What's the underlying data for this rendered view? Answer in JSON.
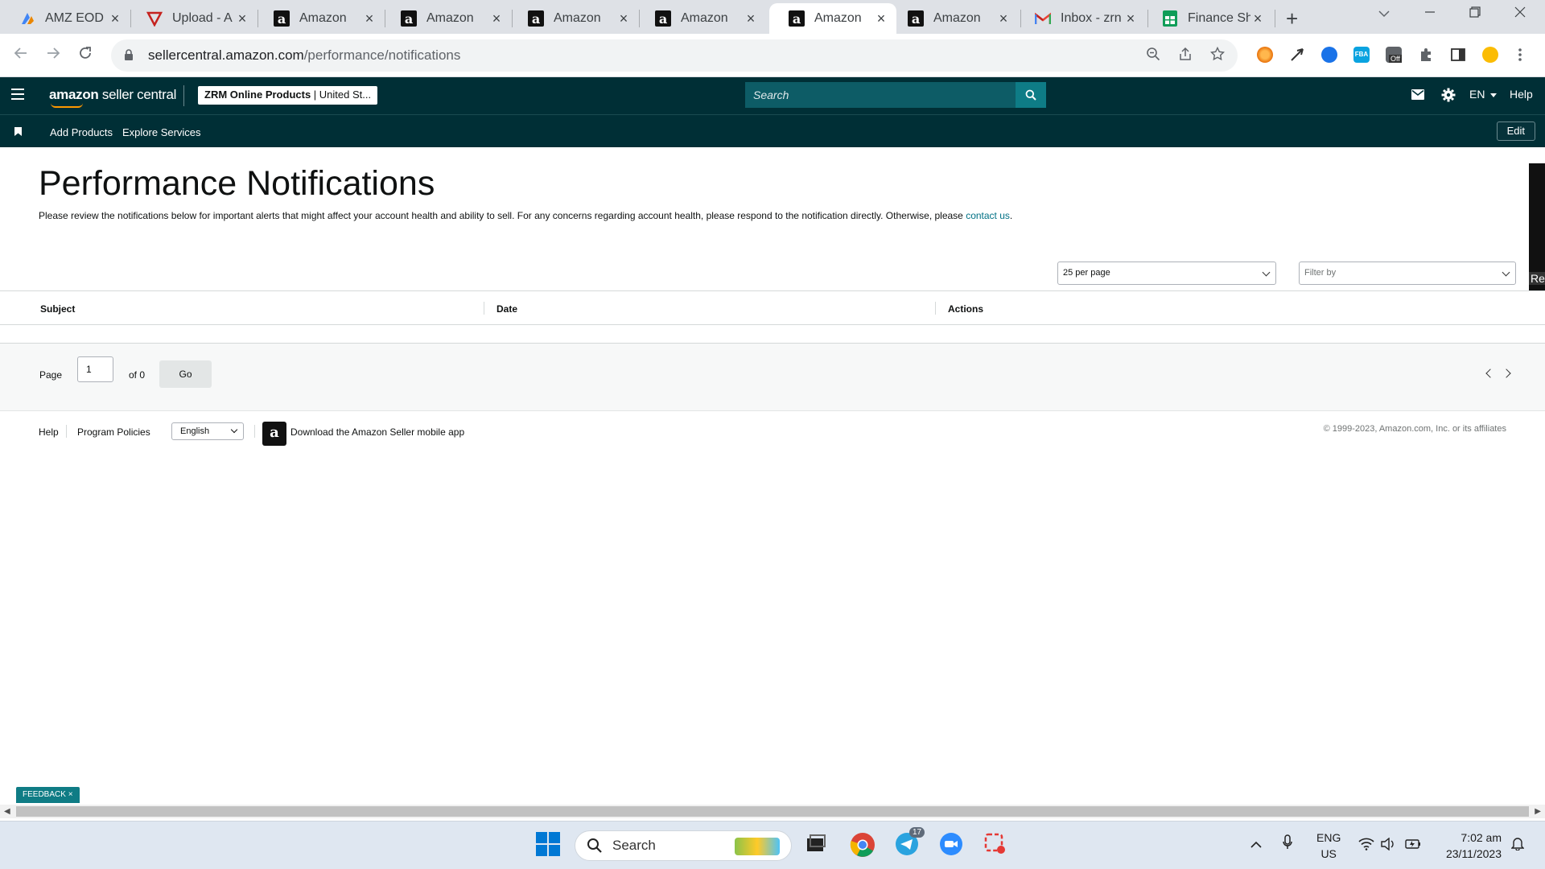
{
  "browser": {
    "tabs": [
      {
        "title": "AMZ EOD I",
        "icon": "amz-eod-favicon",
        "active": false
      },
      {
        "title": "Upload - A",
        "icon": "upload-favicon",
        "active": false
      },
      {
        "title": "Amazon",
        "icon": "amazon-favicon",
        "active": false
      },
      {
        "title": "Amazon",
        "icon": "amazon-favicon",
        "active": false
      },
      {
        "title": "Amazon",
        "icon": "amazon-favicon",
        "active": false
      },
      {
        "title": "Amazon",
        "icon": "amazon-favicon",
        "active": false
      },
      {
        "title": "Amazon",
        "icon": "amazon-favicon",
        "active": true
      },
      {
        "title": "Amazon",
        "icon": "amazon-favicon",
        "active": false
      },
      {
        "title": "Inbox - zrn",
        "icon": "gmail-favicon",
        "active": false
      },
      {
        "title": "Finance Sh",
        "icon": "sheets-favicon",
        "active": false
      }
    ],
    "url_host": "sellercentral.amazon.com",
    "url_path": "/performance/notifications",
    "extension_badge": "Off"
  },
  "seller_nav": {
    "logo_bold": "amazon",
    "logo_rest": " seller central",
    "store_name": "ZRM Online Products",
    "store_region": "United St...",
    "search_placeholder": "Search",
    "language": "EN",
    "help_label": "Help",
    "sub_items": [
      "Add Products",
      "Explore Services"
    ],
    "edit_label": "Edit"
  },
  "page": {
    "title": "Performance Notifications",
    "description": "Please review the notifications below for important alerts that might affect your account health and ability to sell. For any concerns regarding account health, please respond to the notification directly. Otherwise, please",
    "contact_link": "contact us",
    "per_page": "25 per page",
    "filter_placeholder": "Filter by",
    "columns": [
      "Subject",
      "Date",
      "Actions"
    ],
    "rows": [],
    "pager": {
      "page_label": "Page",
      "page_value": "1",
      "of_label": "of 0",
      "go_label": "Go"
    },
    "side_strip_text": "Re"
  },
  "footer": {
    "help": "Help",
    "policies": "Program Policies",
    "language": "English",
    "app_link": "Download the Amazon Seller mobile app",
    "copyright": "© 1999-2023, Amazon.com, Inc. or its affiliates"
  },
  "feedback_label": "FEEDBACK",
  "taskbar": {
    "search_placeholder": "Search",
    "telegram_badge": "17",
    "lang_line1": "ENG",
    "lang_line2": "US",
    "time": "7:02 am",
    "date": "23/11/2023"
  },
  "colors": {
    "nav_bg": "#002f36",
    "search_bg": "#0d5c66",
    "search_btn": "#0e7c86",
    "link": "#007185",
    "feedback": "#0f7c85"
  }
}
